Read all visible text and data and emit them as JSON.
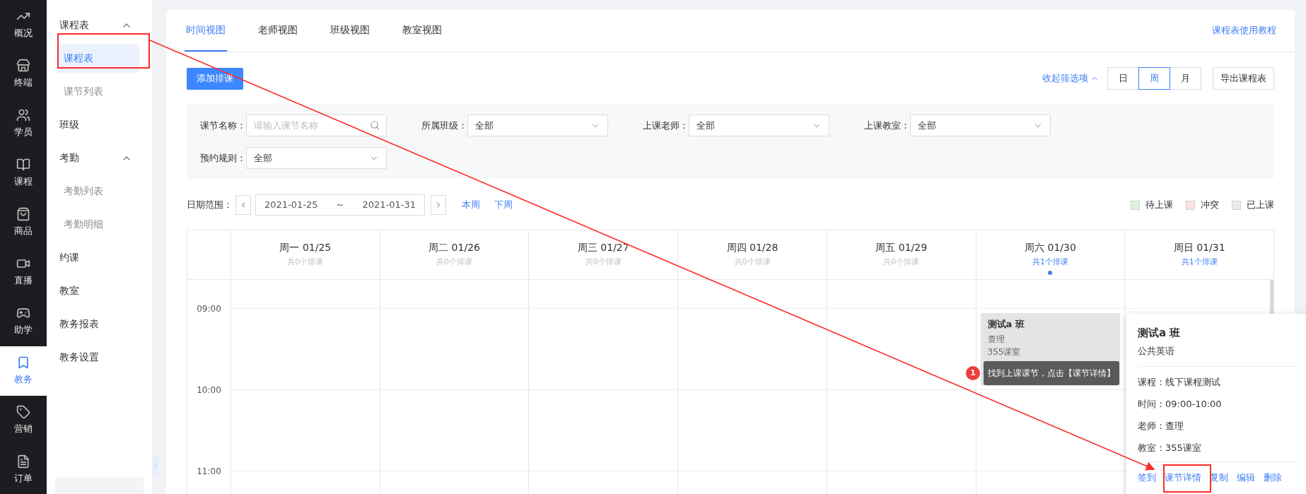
{
  "nav": [
    {
      "label": "概况",
      "selected": false
    },
    {
      "label": "终端",
      "selected": false
    },
    {
      "label": "学员",
      "selected": false
    },
    {
      "label": "课程",
      "selected": false
    },
    {
      "label": "商品",
      "selected": false
    },
    {
      "label": "直播",
      "selected": false
    },
    {
      "label": "助学",
      "selected": false
    },
    {
      "label": "教务",
      "selected": true
    },
    {
      "label": "营销",
      "selected": false
    },
    {
      "label": "订单",
      "selected": false
    }
  ],
  "subnav": [
    {
      "label": "课程表",
      "expanded": true,
      "selected": false,
      "children": [
        {
          "label": "课程表",
          "selected": true
        },
        {
          "label": "课节列表",
          "selected": false
        }
      ]
    },
    {
      "label": "班级",
      "selected": false
    },
    {
      "label": "考勤",
      "expanded": true,
      "selected": false,
      "children": [
        {
          "label": "考勤列表",
          "selected": false
        },
        {
          "label": "考勤明细",
          "selected": false
        }
      ]
    },
    {
      "label": "约课",
      "selected": false
    },
    {
      "label": "教室",
      "selected": false
    },
    {
      "label": "教务报表",
      "selected": false
    },
    {
      "label": "教务设置",
      "selected": false
    }
  ],
  "tabs": [
    {
      "label": "时间视图",
      "selected": true
    },
    {
      "label": "老师视图",
      "selected": false
    },
    {
      "label": "班级视图",
      "selected": false
    },
    {
      "label": "教室视图",
      "selected": false
    }
  ],
  "help_link": "课程表使用教程",
  "add_button": "添加排课",
  "collapse_filters": "收起筛选项",
  "view_modes": [
    {
      "label": "日",
      "selected": false
    },
    {
      "label": "周",
      "selected": true
    },
    {
      "label": "月",
      "selected": false
    }
  ],
  "export_button": "导出课程表",
  "filters": [
    {
      "kind": "search",
      "label": "课节名称：",
      "placeholder": "请输入课节名称"
    },
    {
      "kind": "select",
      "label": "所属班级：",
      "value": "全部"
    },
    {
      "kind": "select",
      "label": "上课老师：",
      "value": "全部"
    },
    {
      "kind": "select",
      "label": "上课教室：",
      "value": "全部"
    },
    {
      "kind": "select",
      "label": "预约规则：",
      "value": "全部"
    }
  ],
  "date_range": {
    "label": "日期范围：",
    "start": "2021-01-25",
    "separator": "~",
    "end": "2021-01-31",
    "links": [
      "本周",
      "下周"
    ]
  },
  "legend": [
    {
      "label": "待上课",
      "color": "#dcf5dc"
    },
    {
      "label": "冲突",
      "color": "#fde2e2"
    },
    {
      "label": "已上课",
      "color": "#ececec"
    }
  ],
  "days": [
    {
      "title": "周一 01/25",
      "count": "共0个排课",
      "highlighted": false,
      "selected": false
    },
    {
      "title": "周二 01/26",
      "count": "共0个排课",
      "highlighted": false,
      "selected": false
    },
    {
      "title": "周三 01/27",
      "count": "共0个排课",
      "highlighted": false,
      "selected": false
    },
    {
      "title": "周四 01/28",
      "count": "共0个排课",
      "highlighted": false,
      "selected": false
    },
    {
      "title": "周五 01/29",
      "count": "共0个排课",
      "highlighted": false,
      "selected": false
    },
    {
      "title": "周六 01/30",
      "count": "共1个排课",
      "highlighted": true,
      "selected": true,
      "events": [
        {
          "title": "测试a 班",
          "teacher": "查理",
          "room": "355课室"
        }
      ]
    },
    {
      "title": "周日 01/31",
      "count": "共1个排课",
      "highlighted": true,
      "selected": false
    }
  ],
  "times": [
    "09:00",
    "10:00",
    "11:00"
  ],
  "popover": {
    "title": "测试a 班",
    "subtitle": "公共英语",
    "details": [
      "课程：线下课程测试",
      "时间：09:00-10:00",
      "老师：查理",
      "教室：355课室"
    ],
    "actions": [
      "签到",
      "课节详情",
      "复制",
      "编辑",
      "删除"
    ]
  },
  "tooltip": {
    "step": "1",
    "text": "找到上课课节，点击【课节详情】"
  }
}
